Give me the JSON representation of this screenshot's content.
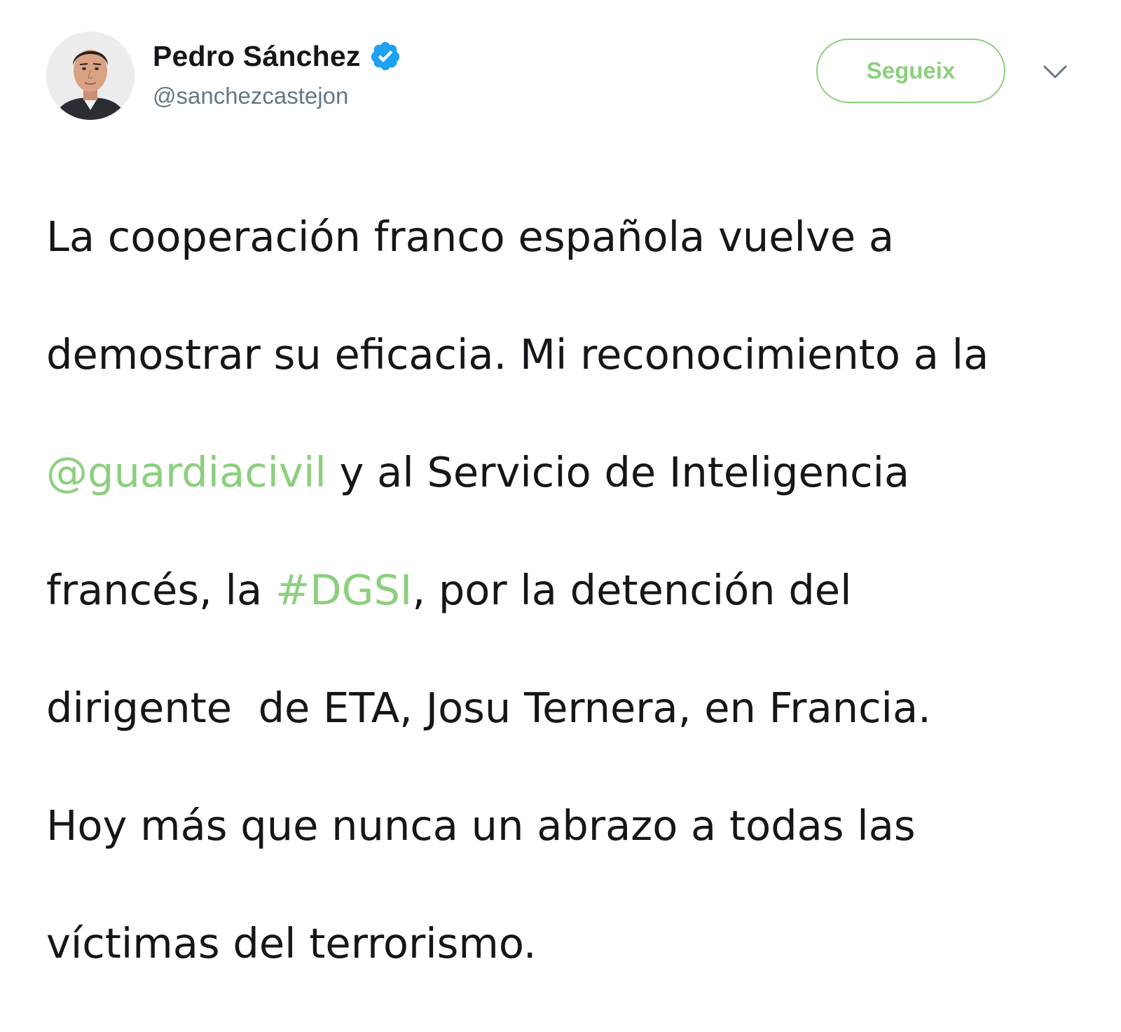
{
  "author": {
    "display_name": "Pedro Sánchez",
    "handle": "@sanchezcastejon",
    "verified": true,
    "avatar_icon": "portrait-avatar"
  },
  "actions": {
    "follow_label": "Segueix",
    "menu_icon": "chevron-down-icon"
  },
  "colors": {
    "accent": "#8ccf7e",
    "verified": "#1da1f2",
    "text": "#14171a",
    "muted": "#657786"
  },
  "tweet": {
    "lines": [
      [
        "La cooperación franco española vuelve a"
      ],
      [
        "demostrar su eficacia. Mi reconocimiento a la"
      ],
      [
        "@guardiacivil",
        " y al Servicio de Inteligencia"
      ],
      [
        "francés, la ",
        "#DGSI",
        ", por la detención del"
      ],
      [
        "dirigente  de ETA, Josu Ternera, en Francia."
      ],
      [
        "Hoy más que nunca un abrazo a todas las"
      ],
      [
        "víctimas del terrorismo."
      ]
    ],
    "mention": "@guardiacivil",
    "hashtag": "#DGSI"
  }
}
